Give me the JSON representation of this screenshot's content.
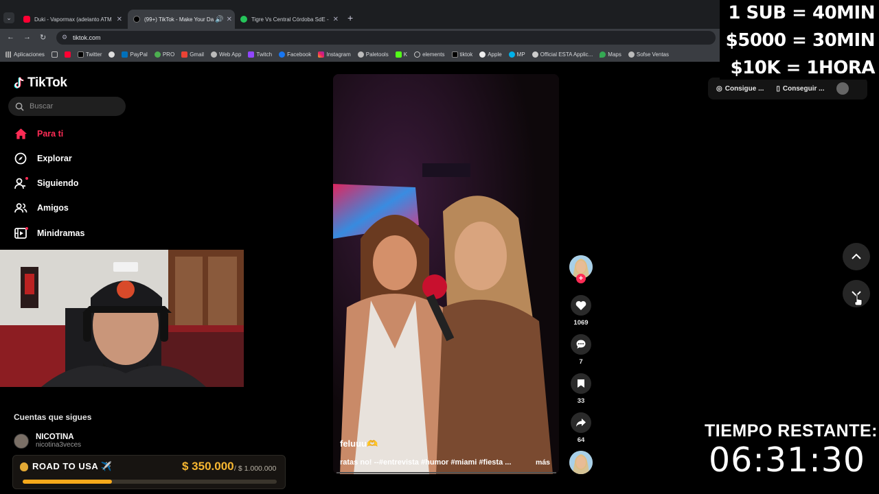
{
  "browser": {
    "tabs": [
      {
        "title": "Duki - Vapormax (adelanto ATM",
        "color": "#ff0033"
      },
      {
        "title": "(99+) TikTok - Make Your Da",
        "color": "#ffffff"
      },
      {
        "title": "Tigre Vs Central Córdoba SdE -",
        "color": "#25c45a"
      }
    ],
    "url": "tiktok.com",
    "bookmarks": [
      "Aplicaciones",
      "Twitter",
      "PayPal",
      "PRO",
      "Gmail",
      "Web App",
      "Twitch",
      "Facebook",
      "Instagram",
      "Paletools",
      "K",
      "elements",
      "tiktok",
      "Apple",
      "MP",
      "Official ESTA Applic...",
      "Maps",
      "Sofse Ventas"
    ]
  },
  "tiktok": {
    "logo": "TikTok",
    "search_placeholder": "Buscar",
    "menu": [
      "Para ti",
      "Explorar",
      "Siguiendo",
      "Amigos",
      "Minidramas"
    ],
    "following_header": "Cuentas que sigues",
    "follow_account": {
      "name": "NICOTINA",
      "handle": "nicotina3veces"
    },
    "top_right": {
      "btn1": "Consigue ...",
      "btn2": "Conseguir ..."
    },
    "video": {
      "author": "feluuu🫶",
      "caption": "ratas no! --#entrevista #humor #miami #fiesta ...",
      "more": "más"
    },
    "actions": {
      "likes": "1069",
      "comments": "7",
      "saves": "33",
      "shares": "64"
    }
  },
  "overlay": {
    "line1": "1 SUB = 40MIN",
    "line2": "$5000 = 30MIN",
    "line3": "$10K = 1HORA",
    "timer_label": "TIEMPO RESTANTE:",
    "timer_value": "06:31:30"
  },
  "goal": {
    "title": "ROAD TO USA ✈️",
    "amount": "$ 350.000",
    "total": "/ $ 1.000.000",
    "progress": 0.35
  },
  "colors": {
    "accent": "#fe2c55",
    "goal": "#f7b731"
  }
}
